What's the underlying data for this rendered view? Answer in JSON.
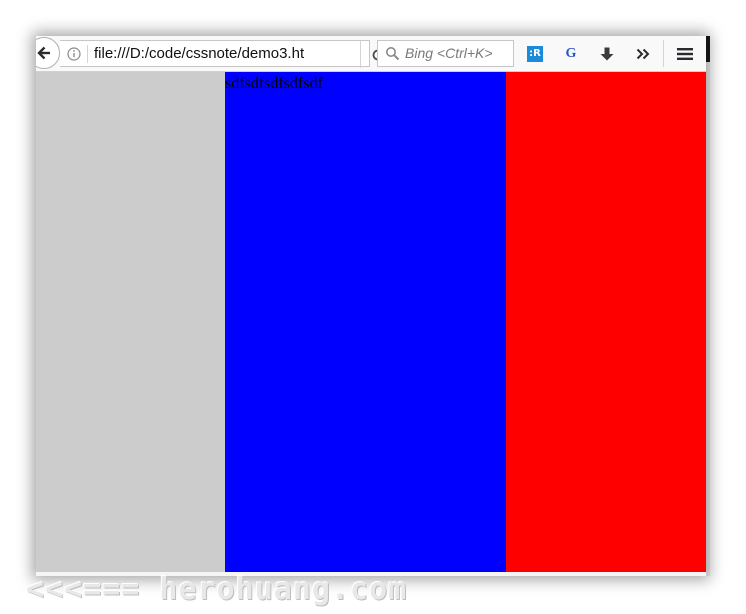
{
  "browser": {
    "url": "file:///D:/code/cssnote/demo3.ht",
    "search_placeholder": "Bing <Ctrl+K>",
    "icons": [
      "back-arrow-icon",
      "info-icon",
      "reload-icon",
      "search-icon",
      "extension-r-icon",
      "extension-g-icon",
      "download-icon",
      "overflow-chevron-icon",
      "hamburger-menu-icon"
    ],
    "ext_r_label": ":R",
    "ext_g_label": "G"
  },
  "page": {
    "text": "sdfsdfsdfsdfsdf",
    "colors": {
      "left_column": "#cccccc",
      "middle_column": "#0000ff",
      "right_column": "#ff0000"
    }
  },
  "watermark": "<<<=== herohuang.com"
}
